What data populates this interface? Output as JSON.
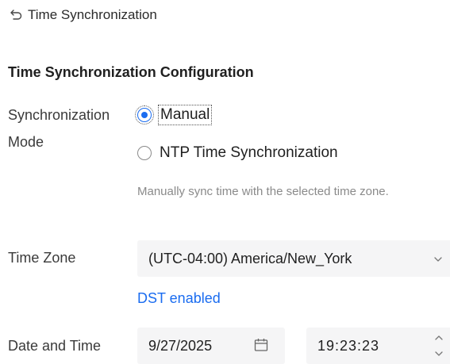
{
  "header": {
    "back_icon": "back-arrow-icon",
    "title": "Time Synchronization"
  },
  "section": {
    "title": "Time Synchronization Configuration"
  },
  "sync_mode": {
    "label_line1": "Synchronization",
    "label_line2": "Mode",
    "options": [
      {
        "label": "Manual",
        "selected": true
      },
      {
        "label": "NTP Time Synchronization",
        "selected": false
      }
    ],
    "hint": "Manually sync time with the selected time zone."
  },
  "time_zone": {
    "label": "Time Zone",
    "value": "(UTC-04:00) America/New_York",
    "icon": "chevron-down-icon"
  },
  "dst": {
    "label": "DST enabled"
  },
  "date_time": {
    "label": "Date and Time",
    "date": "9/27/2025",
    "date_icon": "calendar-icon",
    "time": "19:23:23",
    "time_icons": [
      "chevron-up-icon",
      "chevron-down-icon"
    ]
  },
  "colors": {
    "accent": "#1a6cf0",
    "input_bg": "#f5f5f6",
    "hint_text": "#8a8a8a"
  }
}
